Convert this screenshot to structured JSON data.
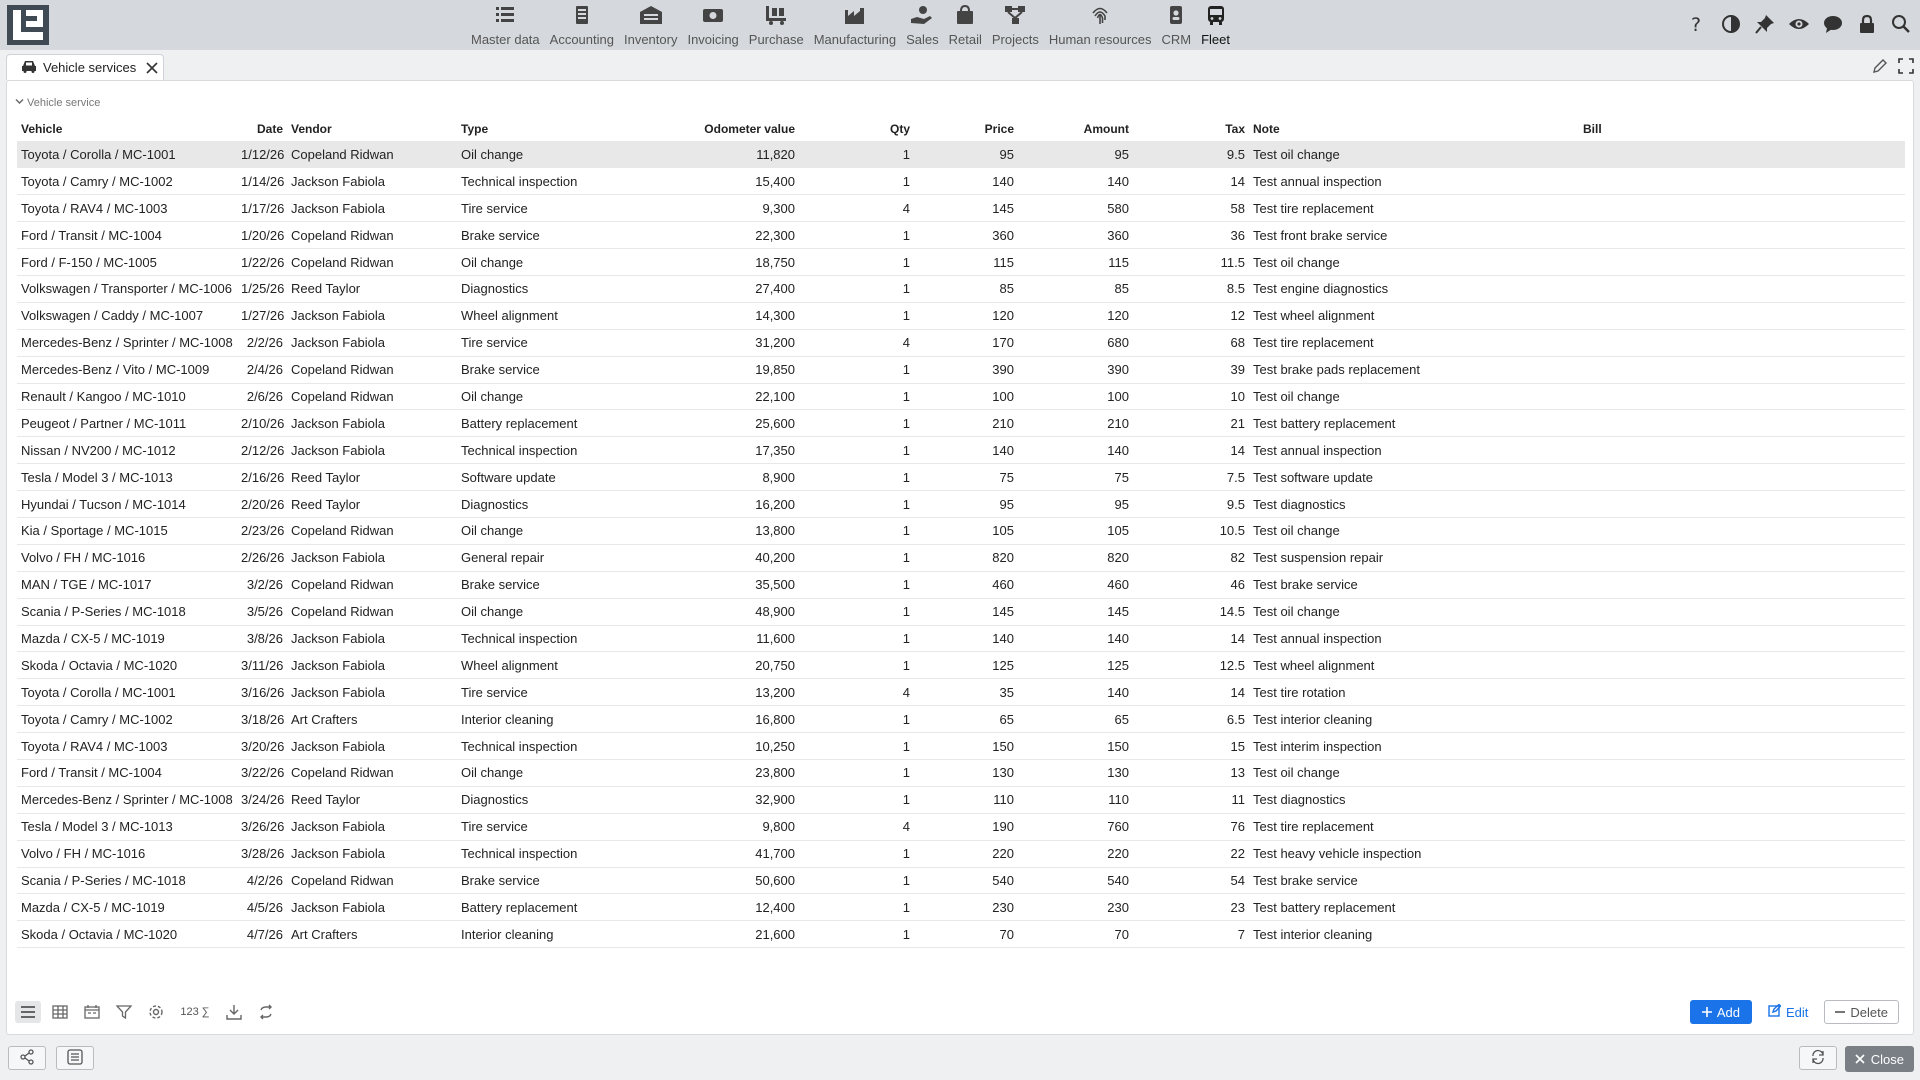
{
  "nav": {
    "modules": [
      {
        "label": "Master data",
        "icon": "list-icon"
      },
      {
        "label": "Accounting",
        "icon": "ledger-icon"
      },
      {
        "label": "Inventory",
        "icon": "warehouse-icon"
      },
      {
        "label": "Invoicing",
        "icon": "cash-icon"
      },
      {
        "label": "Purchase",
        "icon": "truck-loading-icon"
      },
      {
        "label": "Manufacturing",
        "icon": "factory-icon"
      },
      {
        "label": "Sales",
        "icon": "hand-coin-icon"
      },
      {
        "label": "Retail",
        "icon": "shopping-bag-icon"
      },
      {
        "label": "Projects",
        "icon": "network-icon"
      },
      {
        "label": "Human resources",
        "icon": "fingerprint-icon"
      },
      {
        "label": "CRM",
        "icon": "contact-card-icon"
      },
      {
        "label": "Fleet",
        "icon": "bus-icon"
      }
    ],
    "active": "Fleet",
    "right_icons": [
      "help-icon",
      "contrast-icon",
      "pin-icon",
      "eye-icon",
      "chat-icon",
      "lock-icon",
      "search-icon"
    ]
  },
  "tab": {
    "label": "Vehicle services",
    "icon": "car-icon"
  },
  "section": {
    "title": "Vehicle service"
  },
  "table": {
    "columns": [
      "Vehicle",
      "Date",
      "Vendor",
      "Type",
      "Odometer value",
      "Qty",
      "Price",
      "Amount",
      "Tax",
      "Note",
      "Bill"
    ],
    "rows": [
      [
        "Toyota / Corolla / MC-1001",
        "1/12/26",
        "Copeland Ridwan",
        "Oil change",
        "11,820",
        "1",
        "95",
        "95",
        "9.5",
        "Test oil change",
        ""
      ],
      [
        "Toyota / Camry / MC-1002",
        "1/14/26",
        "Jackson Fabiola",
        "Technical inspection",
        "15,400",
        "1",
        "140",
        "140",
        "14",
        "Test annual inspection",
        ""
      ],
      [
        "Toyota / RAV4 / MC-1003",
        "1/17/26",
        "Jackson Fabiola",
        "Tire service",
        "9,300",
        "4",
        "145",
        "580",
        "58",
        "Test tire replacement",
        ""
      ],
      [
        "Ford / Transit / MC-1004",
        "1/20/26",
        "Copeland Ridwan",
        "Brake service",
        "22,300",
        "1",
        "360",
        "360",
        "36",
        "Test front brake service",
        ""
      ],
      [
        "Ford / F-150 / MC-1005",
        "1/22/26",
        "Copeland Ridwan",
        "Oil change",
        "18,750",
        "1",
        "115",
        "115",
        "11.5",
        "Test oil change",
        ""
      ],
      [
        "Volkswagen / Transporter / MC-1006",
        "1/25/26",
        "Reed Taylor",
        "Diagnostics",
        "27,400",
        "1",
        "85",
        "85",
        "8.5",
        "Test engine diagnostics",
        ""
      ],
      [
        "Volkswagen / Caddy / MC-1007",
        "1/27/26",
        "Jackson Fabiola",
        "Wheel alignment",
        "14,300",
        "1",
        "120",
        "120",
        "12",
        "Test wheel alignment",
        ""
      ],
      [
        "Mercedes-Benz / Sprinter / MC-1008",
        "2/2/26",
        "Jackson Fabiola",
        "Tire service",
        "31,200",
        "4",
        "170",
        "680",
        "68",
        "Test tire replacement",
        ""
      ],
      [
        "Mercedes-Benz / Vito / MC-1009",
        "2/4/26",
        "Copeland Ridwan",
        "Brake service",
        "19,850",
        "1",
        "390",
        "390",
        "39",
        "Test brake pads replacement",
        ""
      ],
      [
        "Renault / Kangoo / MC-1010",
        "2/6/26",
        "Copeland Ridwan",
        "Oil change",
        "22,100",
        "1",
        "100",
        "100",
        "10",
        "Test oil change",
        ""
      ],
      [
        "Peugeot / Partner / MC-1011",
        "2/10/26",
        "Jackson Fabiola",
        "Battery replacement",
        "25,600",
        "1",
        "210",
        "210",
        "21",
        "Test battery replacement",
        ""
      ],
      [
        "Nissan / NV200 / MC-1012",
        "2/12/26",
        "Jackson Fabiola",
        "Technical inspection",
        "17,350",
        "1",
        "140",
        "140",
        "14",
        "Test annual inspection",
        ""
      ],
      [
        "Tesla / Model 3 / MC-1013",
        "2/16/26",
        "Reed Taylor",
        "Software update",
        "8,900",
        "1",
        "75",
        "75",
        "7.5",
        "Test software update",
        ""
      ],
      [
        "Hyundai / Tucson / MC-1014",
        "2/20/26",
        "Reed Taylor",
        "Diagnostics",
        "16,200",
        "1",
        "95",
        "95",
        "9.5",
        "Test diagnostics",
        ""
      ],
      [
        "Kia / Sportage / MC-1015",
        "2/23/26",
        "Copeland Ridwan",
        "Oil change",
        "13,800",
        "1",
        "105",
        "105",
        "10.5",
        "Test oil change",
        ""
      ],
      [
        "Volvo / FH / MC-1016",
        "2/26/26",
        "Jackson Fabiola",
        "General repair",
        "40,200",
        "1",
        "820",
        "820",
        "82",
        "Test suspension repair",
        ""
      ],
      [
        "MAN / TGE / MC-1017",
        "3/2/26",
        "Copeland Ridwan",
        "Brake service",
        "35,500",
        "1",
        "460",
        "460",
        "46",
        "Test brake service",
        ""
      ],
      [
        "Scania / P-Series / MC-1018",
        "3/5/26",
        "Copeland Ridwan",
        "Oil change",
        "48,900",
        "1",
        "145",
        "145",
        "14.5",
        "Test oil change",
        ""
      ],
      [
        "Mazda / CX-5 / MC-1019",
        "3/8/26",
        "Jackson Fabiola",
        "Technical inspection",
        "11,600",
        "1",
        "140",
        "140",
        "14",
        "Test annual inspection",
        ""
      ],
      [
        "Skoda / Octavia / MC-1020",
        "3/11/26",
        "Jackson Fabiola",
        "Wheel alignment",
        "20,750",
        "1",
        "125",
        "125",
        "12.5",
        "Test wheel alignment",
        ""
      ],
      [
        "Toyota / Corolla / MC-1001",
        "3/16/26",
        "Jackson Fabiola",
        "Tire service",
        "13,200",
        "4",
        "35",
        "140",
        "14",
        "Test tire rotation",
        ""
      ],
      [
        "Toyota / Camry / MC-1002",
        "3/18/26",
        "Art Crafters",
        "Interior cleaning",
        "16,800",
        "1",
        "65",
        "65",
        "6.5",
        "Test interior cleaning",
        ""
      ],
      [
        "Toyota / RAV4 / MC-1003",
        "3/20/26",
        "Jackson Fabiola",
        "Technical inspection",
        "10,250",
        "1",
        "150",
        "150",
        "15",
        "Test interim inspection",
        ""
      ],
      [
        "Ford / Transit / MC-1004",
        "3/22/26",
        "Copeland Ridwan",
        "Oil change",
        "23,800",
        "1",
        "130",
        "130",
        "13",
        "Test oil change",
        ""
      ],
      [
        "Mercedes-Benz / Sprinter / MC-1008",
        "3/24/26",
        "Reed Taylor",
        "Diagnostics",
        "32,900",
        "1",
        "110",
        "110",
        "11",
        "Test diagnostics",
        ""
      ],
      [
        "Tesla / Model 3 / MC-1013",
        "3/26/26",
        "Jackson Fabiola",
        "Tire service",
        "9,800",
        "4",
        "190",
        "760",
        "76",
        "Test tire replacement",
        ""
      ],
      [
        "Volvo / FH / MC-1016",
        "3/28/26",
        "Jackson Fabiola",
        "Technical inspection",
        "41,700",
        "1",
        "220",
        "220",
        "22",
        "Test heavy vehicle inspection",
        ""
      ],
      [
        "Scania / P-Series / MC-1018",
        "4/2/26",
        "Copeland Ridwan",
        "Brake service",
        "50,600",
        "1",
        "540",
        "540",
        "54",
        "Test brake service",
        ""
      ],
      [
        "Mazda / CX-5 / MC-1019",
        "4/5/26",
        "Jackson Fabiola",
        "Battery replacement",
        "12,400",
        "1",
        "230",
        "230",
        "23",
        "Test battery replacement",
        ""
      ],
      [
        "Skoda / Octavia / MC-1020",
        "4/7/26",
        "Art Crafters",
        "Interior cleaning",
        "21,600",
        "1",
        "70",
        "70",
        "7",
        "Test interior cleaning",
        ""
      ]
    ],
    "selected_row": 0
  },
  "toolbar": {
    "view_icons": [
      "list-view-icon",
      "grid-view-icon",
      "calendar-view-icon",
      "filter-icon",
      "settings-icon"
    ],
    "sum_label": "123 ∑",
    "end_icons": [
      "download-icon",
      "refresh-icon"
    ]
  },
  "actions": {
    "add": "Add",
    "edit": "Edit",
    "delete": "Delete"
  },
  "footer": {
    "left_icons": [
      "share-icon",
      "sliders-icon"
    ],
    "reload_icon": "reload-icon",
    "close": "Close"
  },
  "colors": {
    "accent": "#1a73e8",
    "topbar": "#d5d8dc",
    "selected_row": "#e8e8e8",
    "close_button": "#7a7f85"
  }
}
